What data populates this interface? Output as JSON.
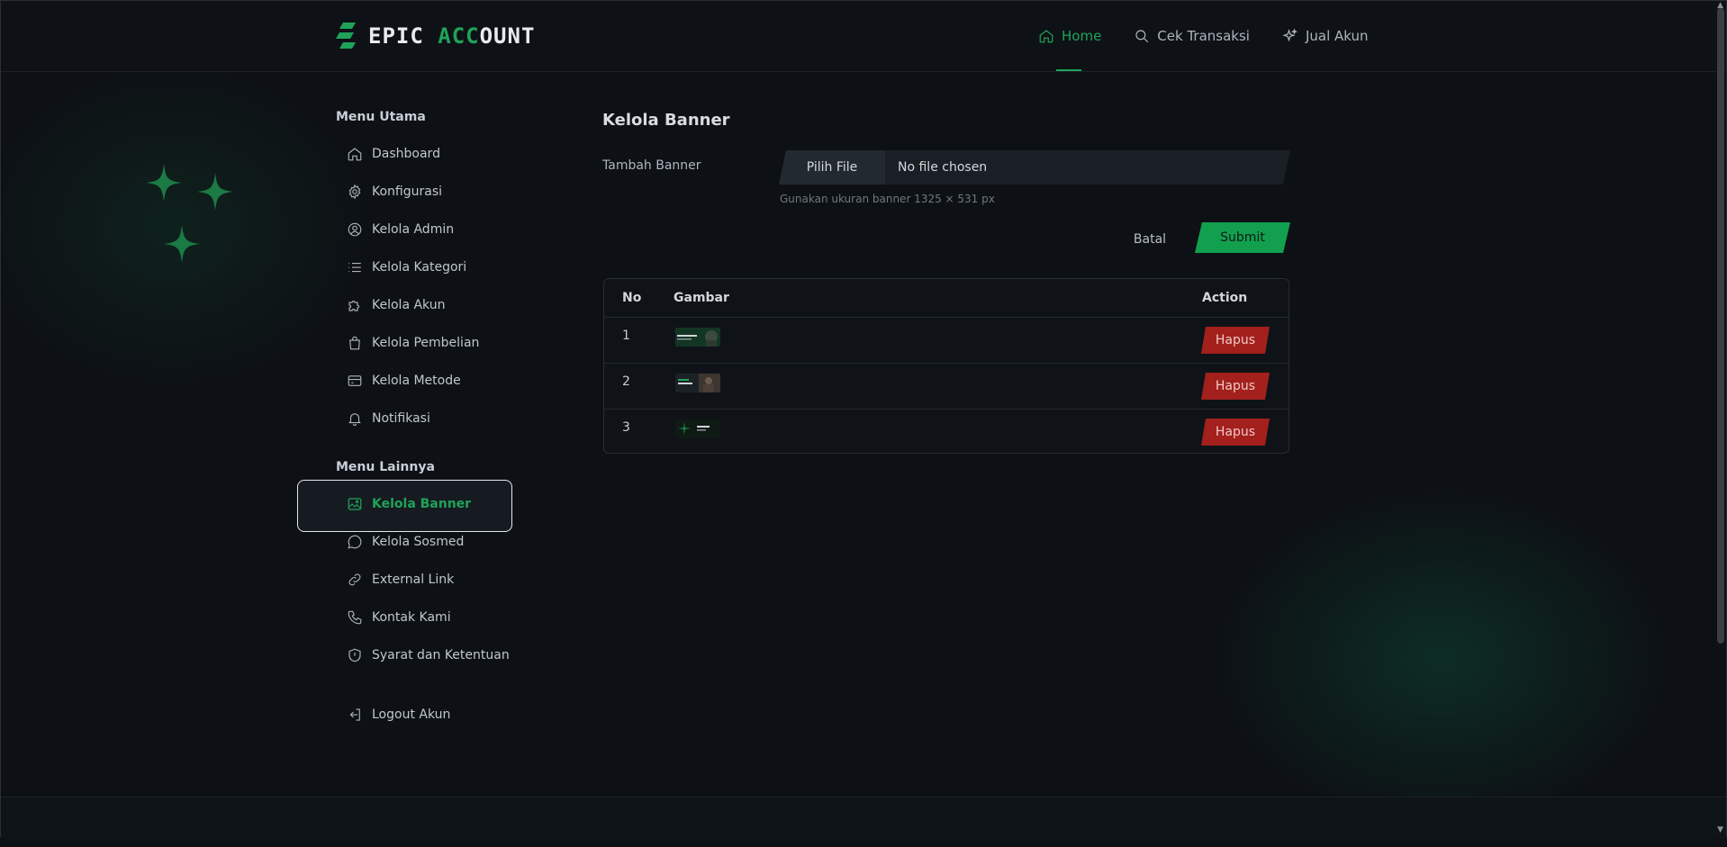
{
  "brand": {
    "part1": "EPIC ",
    "part2_green": "ACC",
    "part3": "OUNT",
    "accent": "#1fa35a"
  },
  "nav": [
    {
      "label": "Home",
      "icon": "home-icon",
      "active": true
    },
    {
      "label": "Cek Transaksi",
      "icon": "search-icon"
    },
    {
      "label": "Jual Akun",
      "icon": "sparkle-icon"
    }
  ],
  "sidebar": {
    "main_title": "Menu Utama",
    "main_items": [
      {
        "label": "Dashboard",
        "icon": "home-icon"
      },
      {
        "label": "Konfigurasi",
        "icon": "gear-icon"
      },
      {
        "label": "Kelola Admin",
        "icon": "user-circle-icon"
      },
      {
        "label": "Kelola Kategori",
        "icon": "list-icon"
      },
      {
        "label": "Kelola Akun",
        "icon": "puzzle-icon"
      },
      {
        "label": "Kelola Pembelian",
        "icon": "shopping-bag-icon"
      },
      {
        "label": "Kelola Metode",
        "icon": "credit-card-icon"
      },
      {
        "label": "Notifikasi",
        "icon": "bell-icon"
      }
    ],
    "other_title": "Menu Lainnya",
    "other_items": [
      {
        "label": "Kelola Banner",
        "icon": "image-icon",
        "active": true
      },
      {
        "label": "Kelola Sosmed",
        "icon": "chat-icon"
      },
      {
        "label": "External Link",
        "icon": "link-icon"
      },
      {
        "label": "Kontak Kami",
        "icon": "phone-icon"
      },
      {
        "label": "Syarat dan Ketentuan",
        "icon": "shield-icon"
      }
    ],
    "logout": {
      "label": "Logout Akun",
      "icon": "logout-icon"
    }
  },
  "main": {
    "title": "Kelola Banner",
    "form": {
      "label": "Tambah Banner",
      "file_button": "Pilih File",
      "file_name": "No file chosen",
      "hint": "Gunakan ukuran banner 1325 × 531 px",
      "cancel": "Batal",
      "submit": "Submit"
    },
    "table": {
      "headers": {
        "no": "No",
        "image": "Gambar",
        "action": "Action"
      },
      "rows": [
        {
          "no": "1",
          "action": "Hapus"
        },
        {
          "no": "2",
          "action": "Hapus"
        },
        {
          "no": "3",
          "action": "Hapus"
        }
      ]
    }
  }
}
